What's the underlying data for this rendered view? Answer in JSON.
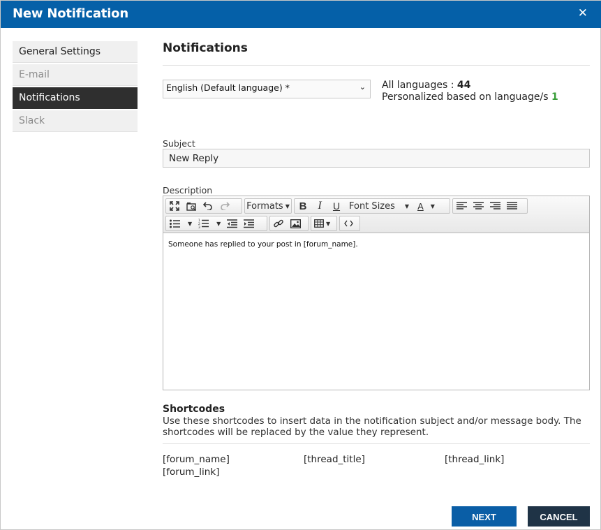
{
  "dialog": {
    "title": "New Notification",
    "close_icon": "✕"
  },
  "sidebar": {
    "items": [
      {
        "label": "General Settings",
        "state": "normal"
      },
      {
        "label": "E-mail",
        "state": "disabled"
      },
      {
        "label": "Notifications",
        "state": "active"
      },
      {
        "label": "Slack",
        "state": "disabled"
      }
    ]
  },
  "main": {
    "title": "Notifications",
    "language": {
      "selected": "English (Default language) *",
      "all_languages_label": "All languages :",
      "all_languages_count": "44",
      "personalized_label": "Personalized based on language/s",
      "personalized_count": "1"
    },
    "subject": {
      "label": "Subject",
      "value": "New Reply"
    },
    "description": {
      "label": "Description",
      "toolbar": {
        "formats": "Formats",
        "font_sizes": "Font Sizes",
        "icons": [
          "fullscreen-icon",
          "preview-icon",
          "undo-icon",
          "redo-icon",
          "bold-icon",
          "italic-icon",
          "underline-icon",
          "text-color-icon",
          "align-left-icon",
          "align-center-icon",
          "align-right-icon",
          "justify-icon",
          "bullet-list-icon",
          "numbered-list-icon",
          "outdent-icon",
          "indent-icon",
          "link-icon",
          "image-icon",
          "table-icon",
          "source-code-icon"
        ]
      },
      "body": "Someone has replied to your post in [forum_name]."
    },
    "shortcodes": {
      "title": "Shortcodes",
      "description": "Use these shortcodes to insert data in the notification subject and/or message body. The shortcodes will be replaced by the value they represent.",
      "codes": [
        "[forum_name]",
        "[thread_title]",
        "[thread_link]",
        "[forum_link]"
      ]
    }
  },
  "buttons": {
    "next": "NEXT",
    "cancel": "CANCEL"
  },
  "colors": {
    "titlebar": "#0560a8",
    "active_item": "#2f2f2f",
    "next": "#0a5ea6",
    "cancel": "#1f3346",
    "count_green": "#3a9e3a"
  }
}
